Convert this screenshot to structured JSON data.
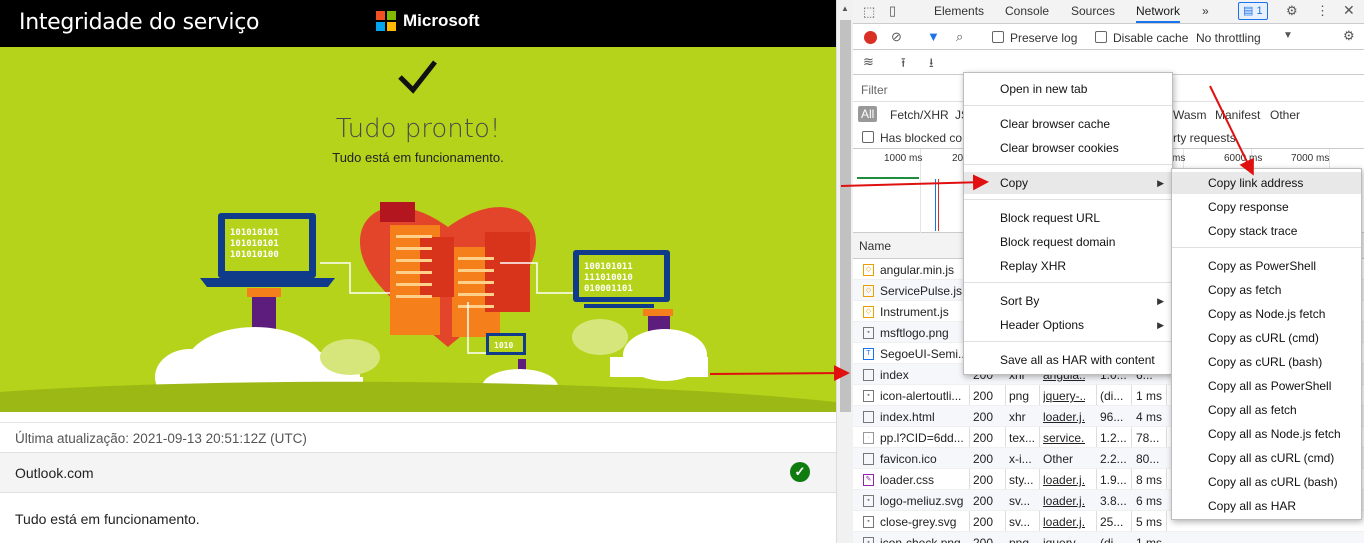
{
  "page": {
    "title": "Integridade do serviço",
    "brand": "Microsoft",
    "hero_title": "Tudo pronto!",
    "hero_subtitle": "Tudo está em funcionamento.",
    "binary_1": [
      "101010101",
      "101010101",
      "101010100"
    ],
    "binary_2": [
      "100101011",
      "111010010",
      "010001101"
    ],
    "binary_3": "1010",
    "last_update": "Última atualização: 2021-09-13 20:51:12Z (UTC)",
    "service_name": "Outlook.com",
    "service_status_message": "Tudo está em funcionamento.",
    "colors": {
      "hero_bg": "#b5d31a",
      "ok": "#107c10",
      "topbar": "#000000"
    }
  },
  "devtools": {
    "tabs": [
      "Elements",
      "Console",
      "Sources",
      "Network"
    ],
    "active_tab": "Network",
    "more_tabs": "»",
    "issues_count": "1",
    "toolbar": {
      "preserve_log": "Preserve log",
      "disable_cache": "Disable cache",
      "throttling": "No throttling"
    },
    "filter_label": "Filter",
    "type_filters": [
      "All",
      "Fetch/XHR",
      "JS",
      "Wasm",
      "Manifest",
      "Other"
    ],
    "blocked_cookies": "Has blocked co",
    "third_party": "rty requests",
    "timeline_ticks": [
      "1000 ms",
      "20",
      "ms",
      "6000 ms",
      "7000 ms"
    ],
    "name_header": "Name",
    "rows": [
      {
        "name": "angular.min.js",
        "status": "",
        "type": "",
        "initiator": "",
        "size": "",
        "time": "",
        "icon": "js"
      },
      {
        "name": "ServicePulse.js",
        "status": "",
        "type": "",
        "initiator": "",
        "size": "",
        "time": "",
        "icon": "js"
      },
      {
        "name": "Instrument.js",
        "status": "",
        "type": "",
        "initiator": "",
        "size": "",
        "time": "",
        "icon": "js"
      },
      {
        "name": "msftlogo.png",
        "status": "",
        "type": "",
        "initiator": "",
        "size": "",
        "time": "",
        "icon": "img"
      },
      {
        "name": "SegoeUI-Semi...",
        "status": "",
        "type": "",
        "initiator": "",
        "size": "",
        "time": "",
        "icon": "font"
      },
      {
        "name": "index",
        "status": "200",
        "type": "xhr",
        "initiator": "angula...",
        "size": "1.0...",
        "time": "6...",
        "icon": "doc"
      },
      {
        "name": "icon-alertoutli...",
        "status": "200",
        "type": "png",
        "initiator": "jquery-...",
        "size": "(di...",
        "time": "1 ms",
        "icon": "img"
      },
      {
        "name": "index.html",
        "status": "200",
        "type": "xhr",
        "initiator": "loader.j...",
        "size": "96...",
        "time": "4 ms",
        "icon": "doc"
      },
      {
        "name": "pp.l?CID=6dd...",
        "status": "200",
        "type": "tex...",
        "initiator": "service...",
        "size": "1.2...",
        "time": "78...",
        "icon": "dot"
      },
      {
        "name": "favicon.ico",
        "status": "200",
        "type": "x-i...",
        "initiator": "Other",
        "size": "2.2...",
        "time": "80...",
        "icon": "doc"
      },
      {
        "name": "loader.css",
        "status": "200",
        "type": "sty...",
        "initiator": "loader.j...",
        "size": "1.9...",
        "time": "8 ms",
        "icon": "css"
      },
      {
        "name": "logo-meliuz.svg",
        "status": "200",
        "type": "sv...",
        "initiator": "loader.j...",
        "size": "3.8...",
        "time": "6 ms",
        "icon": "img"
      },
      {
        "name": "close-grey.svg",
        "status": "200",
        "type": "sv...",
        "initiator": "loader.j...",
        "size": "25...",
        "time": "5 ms",
        "icon": "img"
      },
      {
        "name": "icon-check.png",
        "status": "200",
        "type": "png",
        "initiator": "jquery-...",
        "size": "(di...",
        "time": "1 ms",
        "icon": "img"
      }
    ],
    "context_menu": {
      "open_new_tab": "Open in new tab",
      "clear_cache": "Clear browser cache",
      "clear_cookies": "Clear browser cookies",
      "copy": "Copy",
      "block_url": "Block request URL",
      "block_domain": "Block request domain",
      "replay_xhr": "Replay XHR",
      "sort_by": "Sort By",
      "header_options": "Header Options",
      "save_har": "Save all as HAR with content"
    },
    "copy_submenu": {
      "copy_link": "Copy link address",
      "copy_response": "Copy response",
      "copy_stack": "Copy stack trace",
      "copy_ps": "Copy as PowerShell",
      "copy_fetch": "Copy as fetch",
      "copy_node": "Copy as Node.js fetch",
      "copy_curl_cmd": "Copy as cURL (cmd)",
      "copy_curl_bash": "Copy as cURL (bash)",
      "copy_all_ps": "Copy all as PowerShell",
      "copy_all_fetch": "Copy all as fetch",
      "copy_all_node": "Copy all as Node.js fetch",
      "copy_all_curl_cmd": "Copy all as cURL (cmd)",
      "copy_all_curl_bash": "Copy all as cURL (bash)",
      "copy_all_har": "Copy all as HAR"
    }
  }
}
